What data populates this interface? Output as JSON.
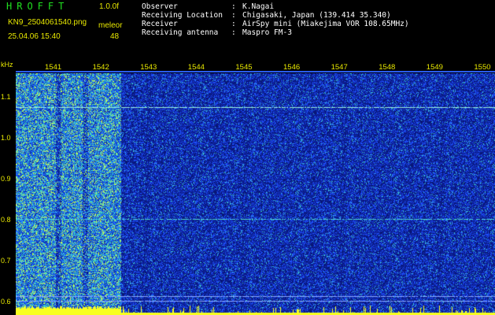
{
  "header": {
    "app_title": "HROFFT",
    "version": "1.0.0f",
    "filename": "KN9_2504061540.png",
    "mode": "meleor",
    "datetime": "25.04.06 15:40",
    "count": "48"
  },
  "meta": [
    {
      "label": "Observer",
      "sep": ":",
      "value": "K.Nagai"
    },
    {
      "label": "Receiving Location",
      "sep": ":",
      "value": "Chigasaki, Japan (139.414 35.340)"
    },
    {
      "label": "Receiver",
      "sep": ":",
      "value": "AirSpy mini (Miakejima VOR 108.65MHz)"
    },
    {
      "label": "Receiving antenna",
      "sep": ":",
      "value": "Maspro FM-3"
    }
  ],
  "axis": {
    "unit_label": "kHz",
    "time_ticks": [
      "1541",
      "1542",
      "1543",
      "1544",
      "1545",
      "1546",
      "1547",
      "1548",
      "1549",
      "1550"
    ],
    "freq_ticks": [
      "1.1",
      "1.0",
      "0.9",
      "0.8",
      "0.7",
      "0.6"
    ],
    "freq_min_khz": 0.57,
    "freq_max_khz": 1.16
  },
  "spectrogram": {
    "type": "heatmap",
    "noise_level": "high",
    "carrier_lines_khz": [
      1.078,
      0.805,
      0.617,
      0.604
    ],
    "colors": {
      "background": "#000000",
      "plot_low": "#0b1f9a",
      "plot_mid": "#1e46ff",
      "plot_high": "#3fd0c0",
      "peak": "#e8ff30",
      "text_yellow": "#e8e800",
      "title_green": "#20e020"
    }
  }
}
